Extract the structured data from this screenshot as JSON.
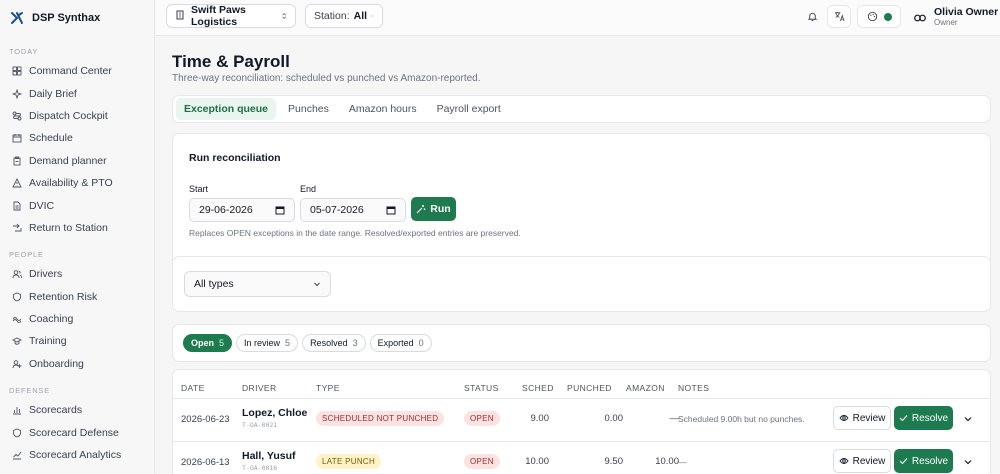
{
  "brand": {
    "name": "DSP Synthax"
  },
  "sidebar": {
    "sections": [
      {
        "title": "TODAY",
        "items": [
          {
            "label": "Command Center",
            "icon": "grid-icon"
          },
          {
            "label": "Daily Brief",
            "icon": "sparkle-icon"
          },
          {
            "label": "Dispatch Cockpit",
            "icon": "route-icon"
          },
          {
            "label": "Schedule",
            "icon": "calendar-icon"
          },
          {
            "label": "Demand planner",
            "icon": "clipboard-icon"
          },
          {
            "label": "Availability & PTO",
            "icon": "warning-icon"
          },
          {
            "label": "DVIC",
            "icon": "document-icon"
          },
          {
            "label": "Return to Station",
            "icon": "return-icon"
          }
        ]
      },
      {
        "title": "PEOPLE",
        "items": [
          {
            "label": "Drivers",
            "icon": "users-icon"
          },
          {
            "label": "Retention Risk",
            "icon": "shield-icon"
          },
          {
            "label": "Coaching",
            "icon": "coaching-icon"
          },
          {
            "label": "Training",
            "icon": "graduation-icon"
          },
          {
            "label": "Onboarding",
            "icon": "user-plus-icon"
          }
        ]
      },
      {
        "title": "DEFENSE",
        "items": [
          {
            "label": "Scorecards",
            "icon": "bar-chart-icon"
          },
          {
            "label": "Scorecard Defense",
            "icon": "shield-icon"
          },
          {
            "label": "Scorecard Analytics",
            "icon": "trend-icon"
          }
        ]
      }
    ]
  },
  "topbar": {
    "org": "Swift Paws Logistics",
    "station_label": "Station:",
    "station_value": "All",
    "user_name": "Olivia Owner",
    "user_role": "Owner",
    "accent": "#1e7a4f"
  },
  "page": {
    "title": "Time & Payroll",
    "subtitle": "Three-way reconciliation: scheduled vs punched vs Amazon-reported."
  },
  "tabs": [
    "Exception queue",
    "Punches",
    "Amazon hours",
    "Payroll export"
  ],
  "reconciliation": {
    "title": "Run reconciliation",
    "start_label": "Start",
    "start_value": "29-06-2026",
    "end_label": "End",
    "end_value": "05-07-2026",
    "run_label": "Run",
    "note": "Replaces OPEN exceptions in the date range. Resolved/exported entries are preserved."
  },
  "filter": {
    "type_value": "All types"
  },
  "status_chips": [
    {
      "label": "Open",
      "count": "5"
    },
    {
      "label": "In review",
      "count": "5"
    },
    {
      "label": "Resolved",
      "count": "3"
    },
    {
      "label": "Exported",
      "count": "0"
    }
  ],
  "table": {
    "headers": [
      "DATE",
      "DRIVER",
      "TYPE",
      "STATUS",
      "SCHED",
      "PUNCHED",
      "AMAZON",
      "NOTES"
    ],
    "rows": [
      {
        "date": "2026-06-23",
        "driver": "Lopez, Chloe",
        "driver_id": "T-OA-0021",
        "type": "SCHEDULED NOT PUNCHED",
        "status": "OPEN",
        "sched": "9.00",
        "punched": "0.00",
        "amazon": "—",
        "notes": "Scheduled 9.00h but no punches.",
        "review": "Review",
        "resolve": "Resolve"
      },
      {
        "date": "2026-06-13",
        "driver": "Hall, Yusuf",
        "driver_id": "T-OA-0016",
        "type": "LATE PUNCH",
        "status": "OPEN",
        "sched": "10.00",
        "punched": "9.50",
        "amazon": "10.00",
        "notes": "—",
        "review": "Review",
        "resolve": "Resolve"
      }
    ]
  }
}
